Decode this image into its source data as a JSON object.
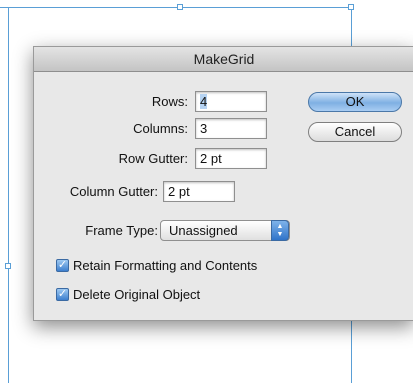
{
  "dialog": {
    "title": "MakeGrid"
  },
  "fields": {
    "rows": {
      "label": "Rows:",
      "value": "4"
    },
    "columns": {
      "label": "Columns:",
      "value": "3"
    },
    "row_gutter": {
      "label": "Row Gutter:",
      "value": "2 pt"
    },
    "column_gutter": {
      "label": "Column Gutter:",
      "value": "2 pt"
    }
  },
  "frame_type": {
    "label": "Frame Type:",
    "selected": "Unassigned"
  },
  "checkboxes": {
    "retain": {
      "label": "Retain Formatting and Contents",
      "checked": true
    },
    "delete_original": {
      "label": "Delete Original Object",
      "checked": true
    }
  },
  "buttons": {
    "ok": "OK",
    "cancel": "Cancel"
  },
  "icons": {
    "checkmark": "checkmark-icon",
    "popup_arrows": "updown-arrows-icon"
  }
}
